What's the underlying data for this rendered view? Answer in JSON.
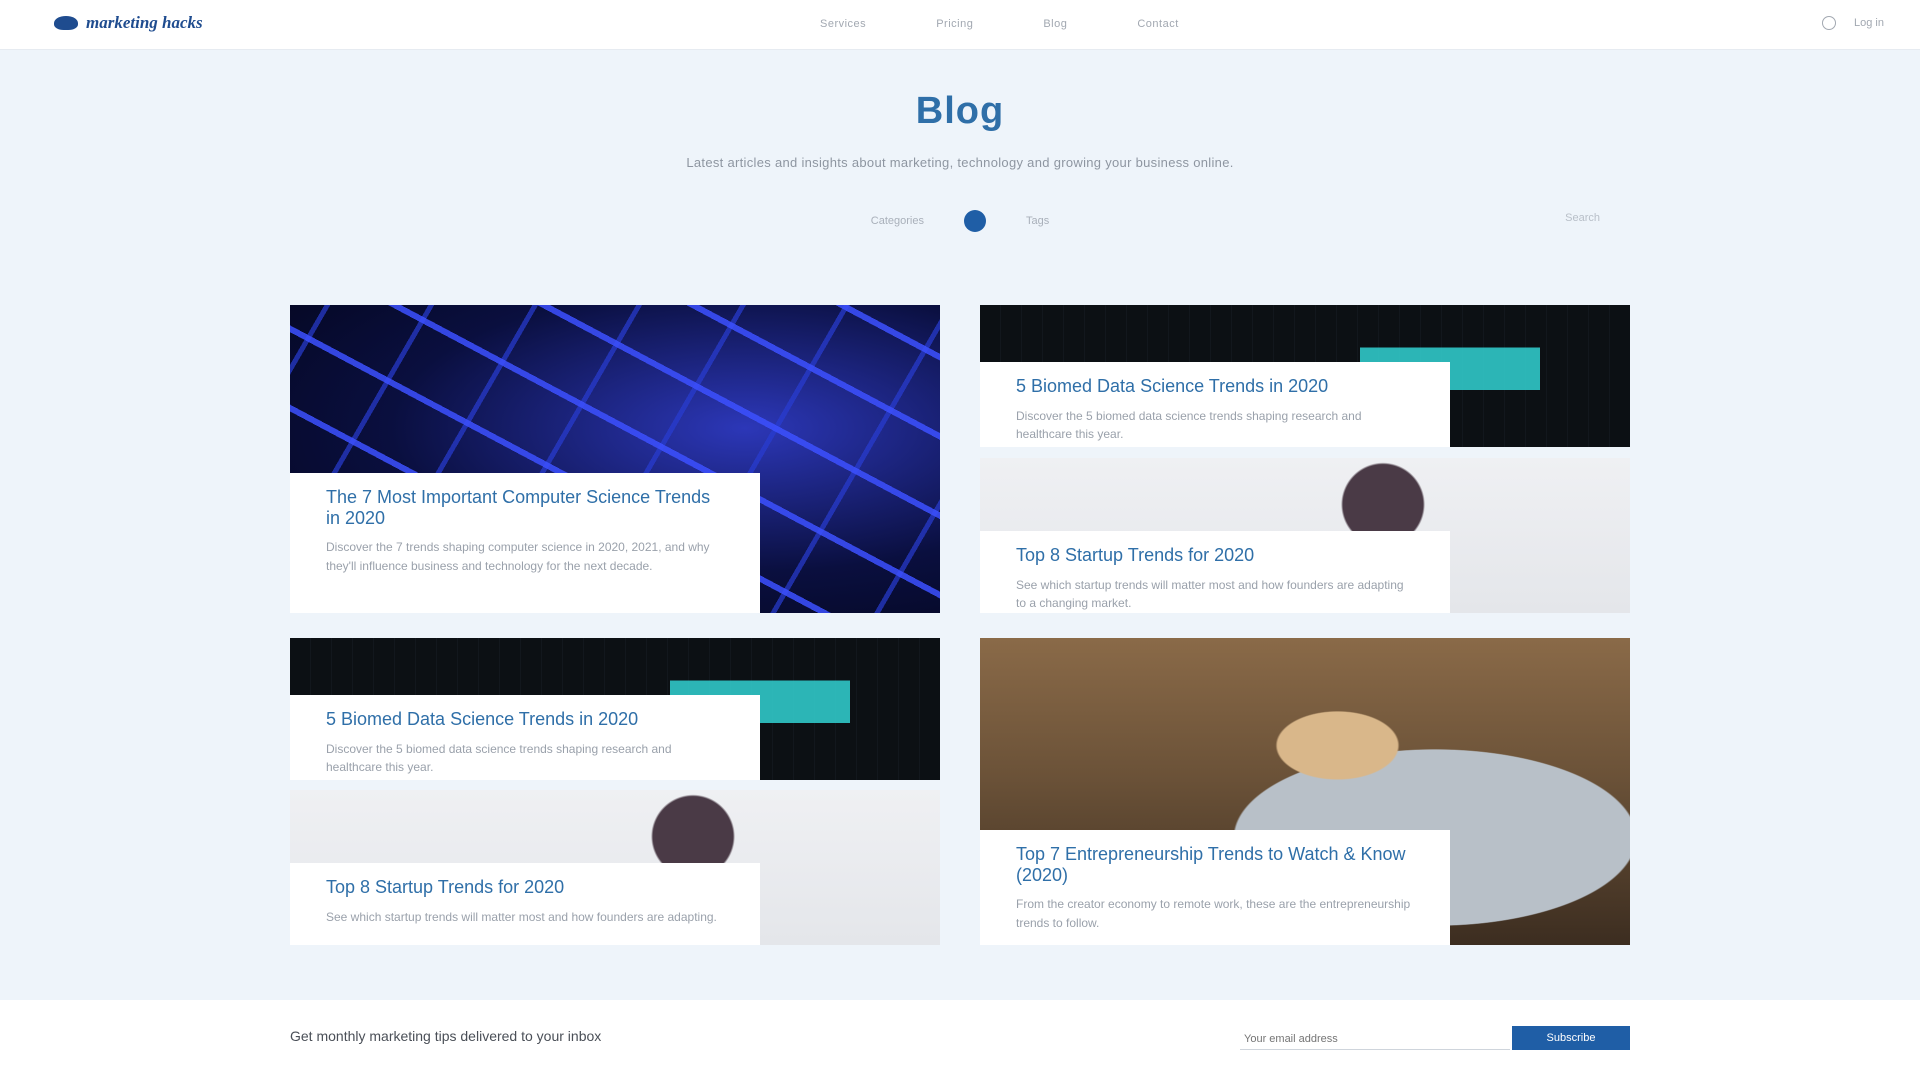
{
  "header": {
    "logo_text": "marketing hacks",
    "nav": [
      "Services",
      "Pricing",
      "Blog",
      "Contact"
    ],
    "login_label": "Log in"
  },
  "hero": {
    "title": "Blog",
    "subtitle": "Latest articles and insights about marketing, technology and growing your business online."
  },
  "filters": {
    "left_label": "Categories",
    "right_label": "Tags",
    "extra_label": "Search"
  },
  "posts": [
    {
      "title": "The 7 Most Important Computer Science Trends in 2020",
      "excerpt": "Discover the 7 trends shaping computer science in 2020, 2021, and why they'll influence business and technology for the next decade."
    },
    {
      "title": "5 Biomed Data Science Trends in 2020",
      "excerpt": "Discover the 5 biomed data science trends shaping research and healthcare this year."
    },
    {
      "title": "Top 8 Startup Trends for 2020",
      "excerpt": "See which startup trends will matter most and how founders are adapting to a changing market."
    },
    {
      "title": "5 Biomed Data Science Trends in 2020",
      "excerpt": "Discover the 5 biomed data science trends shaping research and healthcare this year."
    },
    {
      "title": "Top 8 Startup Trends for 2020",
      "excerpt": "See which startup trends will matter most and how founders are adapting."
    },
    {
      "title": "Top 7 Entrepreneurship Trends to Watch & Know (2020)",
      "excerpt": "From the creator economy to remote work, these are the entrepreneurship trends to follow."
    }
  ],
  "footer": {
    "text": "Get monthly marketing tips delivered to your inbox",
    "email_placeholder": "Your email address",
    "button_label": "Subscribe"
  }
}
